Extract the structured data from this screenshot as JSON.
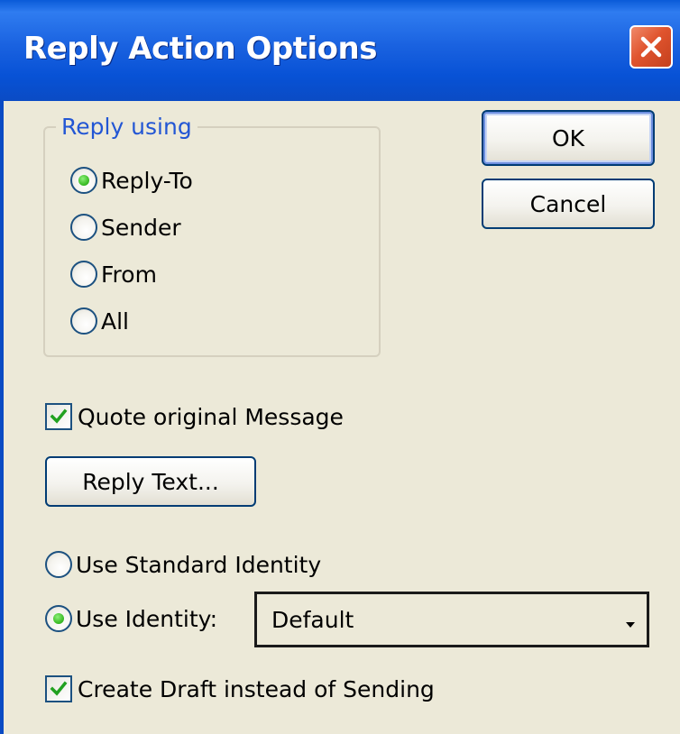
{
  "window": {
    "title": "Reply Action Options"
  },
  "reply_group": {
    "legend": "Reply using",
    "options": [
      {
        "label": "Reply-To",
        "checked": true
      },
      {
        "label": "Sender",
        "checked": false
      },
      {
        "label": "From",
        "checked": false
      },
      {
        "label": "All",
        "checked": false
      }
    ]
  },
  "buttons": {
    "ok": "OK",
    "cancel": "Cancel",
    "reply_text": "Reply Text..."
  },
  "quote_original": {
    "label": "Quote original Message",
    "checked": true
  },
  "identity": {
    "standard_label": "Use Standard Identity",
    "standard_checked": false,
    "custom_label": "Use Identity:",
    "custom_checked": true,
    "selected": "Default"
  },
  "create_draft": {
    "label": "Create Draft instead of Sending",
    "checked": true
  },
  "icons": {
    "close": "close-icon",
    "check": "checkmark-icon",
    "dropdown": "dropdown-arrow-icon"
  },
  "colors": {
    "titlebar": "#0a5bd8",
    "dialog_bg": "#ece9d8",
    "legend_text": "#2256d4",
    "close_button": "#e0542e",
    "check_green": "#21a121"
  }
}
